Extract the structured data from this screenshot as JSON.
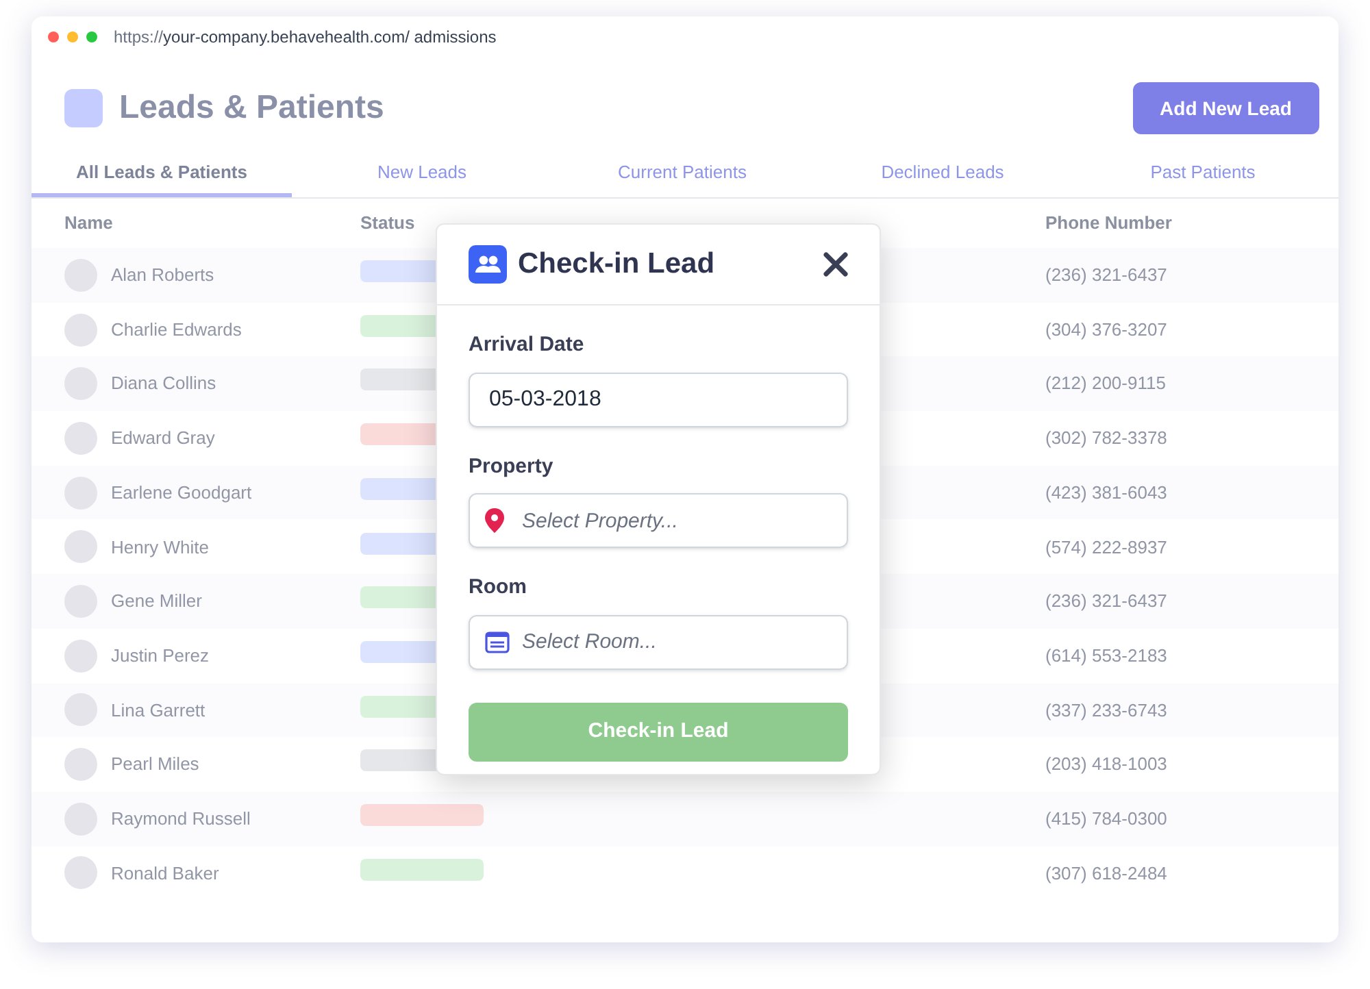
{
  "browser": {
    "scheme": "https://",
    "address": "your-company.behavehealth.com/ admissions"
  },
  "page": {
    "title": "Leads & Patients",
    "add_button": "Add New Lead"
  },
  "tabs": [
    {
      "label": "All Leads & Patients",
      "selected": true
    },
    {
      "label": "New Leads",
      "selected": false
    },
    {
      "label": "Current Patients",
      "selected": false
    },
    {
      "label": "Declined Leads",
      "selected": false
    },
    {
      "label": "Past Patients",
      "selected": false
    }
  ],
  "table": {
    "columns": [
      "Name",
      "Status",
      "Phone Number"
    ],
    "rows": [
      {
        "name": "Alan Roberts",
        "color": "#dbe3ff",
        "phone": "(236) 321-6437"
      },
      {
        "name": "Charlie Edwards",
        "color": "#d9f2dc",
        "phone": "(304) 376-3207"
      },
      {
        "name": "Diana Collins",
        "color": "#e6e7ea",
        "phone": "(212) 200-9115"
      },
      {
        "name": "Edward Gray",
        "color": "#fbdada",
        "phone": "(302) 782-3378"
      },
      {
        "name": "Earlene Goodgart",
        "color": "#dbe3ff",
        "phone": "(423) 381-6043"
      },
      {
        "name": "Henry White",
        "color": "#dbe3ff",
        "phone": "(574) 222-8937"
      },
      {
        "name": "Gene Miller",
        "color": "#d9f2dc",
        "phone": "(236) 321-6437"
      },
      {
        "name": "Justin Perez",
        "color": "#dbe3ff",
        "phone": "(614) 553-2183"
      },
      {
        "name": "Lina Garrett",
        "color": "#d9f2dc",
        "phone": "(337) 233-6743"
      },
      {
        "name": "Pearl Miles",
        "color": "#e6e7ea",
        "phone": "(203) 418-1003"
      },
      {
        "name": "Raymond Russell",
        "color": "#fbdada",
        "phone": "(415) 784-0300"
      },
      {
        "name": "Ronald Baker",
        "color": "#d9f2dc",
        "phone": "(307) 618-2484"
      }
    ]
  },
  "modal": {
    "title": "Check-in Lead",
    "fields": [
      {
        "kind": "date",
        "label": "Arrival Date",
        "value": "05-03-2018"
      },
      {
        "kind": "property",
        "label": "Property",
        "placeholder": "Select Property..."
      },
      {
        "kind": "room",
        "label": "Room",
        "placeholder": "Select Room..."
      }
    ],
    "button": "Check-in Lead"
  }
}
